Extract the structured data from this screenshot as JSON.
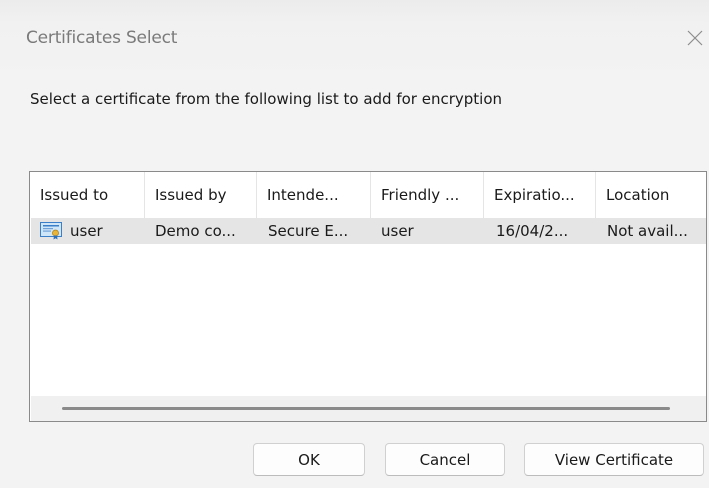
{
  "dialog": {
    "title": "Certificates Select",
    "close_icon": "close-icon",
    "instruction": "Select a certificate from the following list to add for encryption"
  },
  "list": {
    "columns": [
      "Issued to",
      "Issued by",
      "Intende...",
      "Friendly ...",
      "Expiratio...",
      "Location"
    ],
    "rows": [
      {
        "icon": "certificate-icon",
        "issued_to": "user",
        "issued_by": "Demo co...",
        "intended": "Secure E...",
        "friendly": "user",
        "expiration": "16/04/2...",
        "location": "Not avail..."
      }
    ]
  },
  "buttons": {
    "ok": "OK",
    "cancel": "Cancel",
    "view_certificate": "View Certificate"
  }
}
